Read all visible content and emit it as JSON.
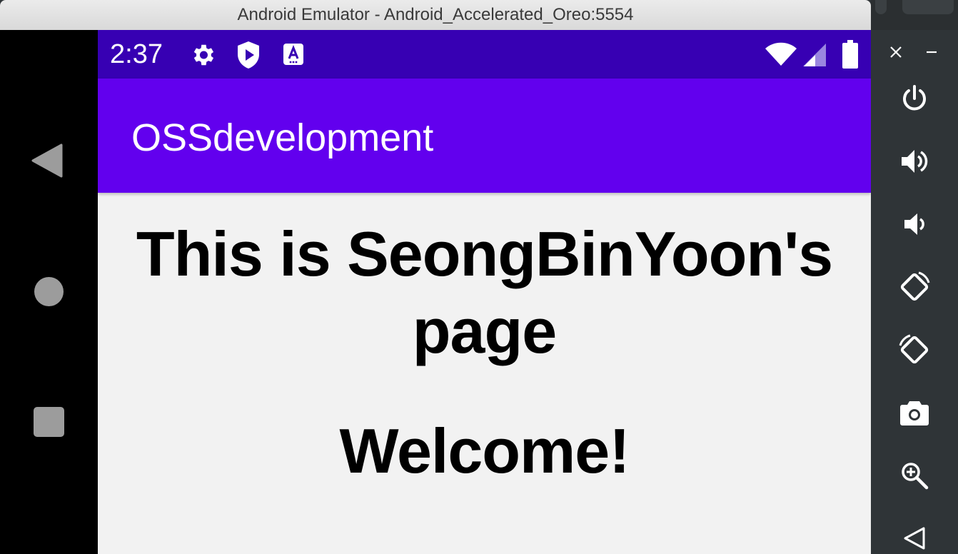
{
  "window": {
    "title": "Android Emulator - Android_Accelerated_Oreo:5554"
  },
  "status_bar": {
    "time": "2:37",
    "left_icons": [
      "gear-icon",
      "play-protect-icon",
      "accessibility-a-icon"
    ],
    "right_icons": [
      "wifi-icon",
      "cell-signal-icon",
      "battery-icon"
    ]
  },
  "app_bar": {
    "title": "OSSdevelopment"
  },
  "content": {
    "heading": "This is SeongBinYoon's page",
    "welcome": "Welcome!"
  },
  "nav": [
    "back-icon",
    "home-icon",
    "recents-icon"
  ],
  "toolbar": [
    "close-icon",
    "minimize-icon",
    "power-icon",
    "volume-up-icon",
    "volume-down-icon",
    "rotate-left-icon",
    "rotate-right-icon",
    "camera-icon",
    "zoom-icon",
    "back-icon"
  ],
  "colors": {
    "status_bar": "#3700b3",
    "app_bar": "#6200ee",
    "screen_bg": "#f2f2f2",
    "toolbar_bg": "#2f3437"
  }
}
